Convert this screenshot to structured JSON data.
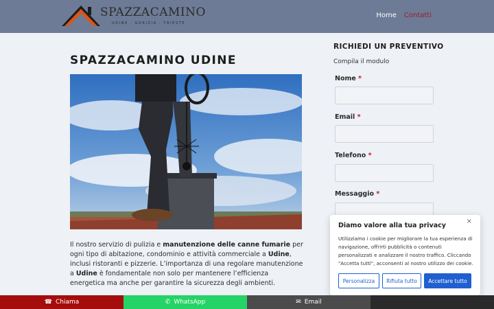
{
  "header": {
    "logo_title": "SPAZZACAMINO",
    "logo_subtitle": "UDINE . GORIZIA . TRIESTE",
    "nav": [
      {
        "label": "Home"
      },
      {
        "label": "Contatti"
      }
    ],
    "colors": {
      "background": "#6e7b96",
      "active_link": "#a3182c"
    }
  },
  "main": {
    "title": "SPAZZACAMINO UDINE",
    "intro_parts": [
      "Il nostro servizio di pulizia e ",
      "manutenzione delle canne fumarie",
      " per ogni tipo di abitazione, condominio e attività commerciale a ",
      "Udine",
      ", inclusi ristoranti e pizzerie. L’importanza di una regolare manutenzione a ",
      "Udine",
      " è fondamentale non solo per mantenere l’efficienza energetica ma anche per garantire la sicurezza degli ambienti."
    ]
  },
  "form": {
    "title": "RICHIEDI UN PREVENTIVO",
    "subtitle": "Compila il modulo",
    "required_mark": "*",
    "fields": [
      {
        "label": "Nome"
      },
      {
        "label": "Email"
      },
      {
        "label": "Telefono"
      },
      {
        "label": "Messaggio"
      }
    ]
  },
  "cookie": {
    "title": "Diamo valore alla tua privacy",
    "close": "×",
    "text": "Utilizziamo i cookie per migliorare la tua esperienza di navigazione, offrirti pubblicità o contenuti personalizzati e analizzare il nostro traffico. Cliccando \"Accetta tutti\", acconsenti al nostro utilizzo dei cookie.",
    "buttons": {
      "customize": "Personalizza",
      "reject": "Rifiuta tutto",
      "accept": "Accettare tutto"
    },
    "colors": {
      "accent": "#1f5fd0"
    }
  },
  "bottom_bar": {
    "call": {
      "icon": "phone-icon",
      "label": "Chiama",
      "color": "#a50d0d"
    },
    "whatsapp": {
      "icon": "whatsapp-icon",
      "label": "WhatsApp",
      "color": "#25d366"
    },
    "email": {
      "icon": "envelope-icon",
      "label": "Email",
      "color": "#4b4b4b"
    }
  }
}
